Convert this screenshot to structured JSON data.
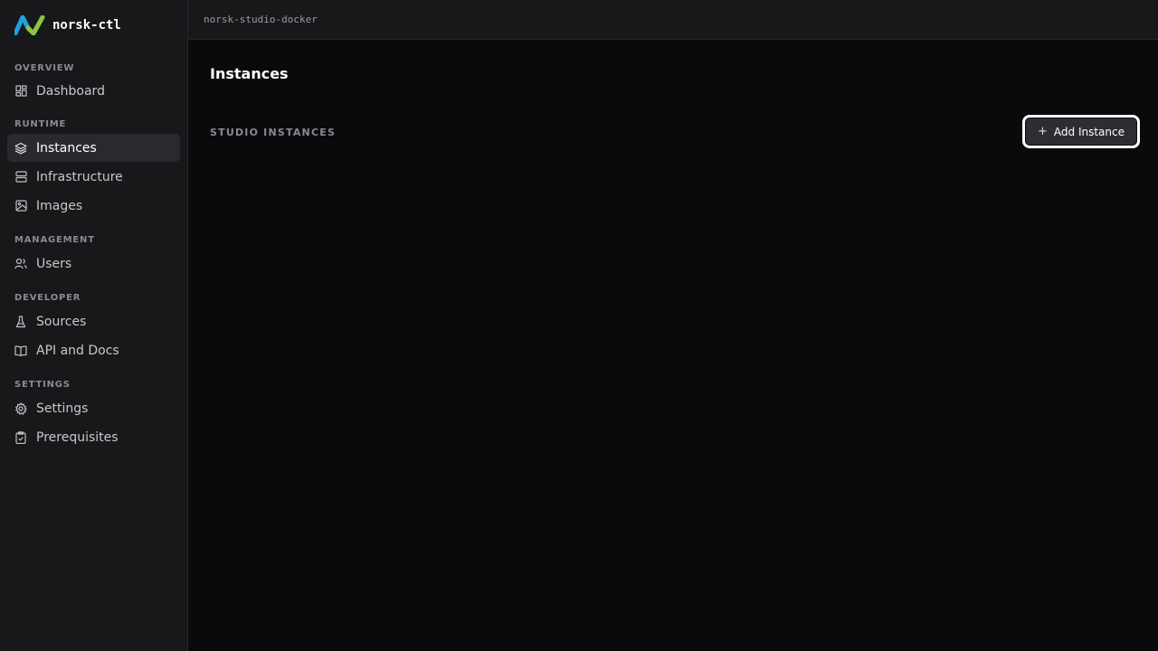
{
  "brand": {
    "name": "norsk-ctl"
  },
  "topbar": {
    "breadcrumb": "norsk-studio-docker"
  },
  "sidebar": {
    "sections": [
      {
        "label": "OVERVIEW",
        "items": [
          {
            "label": "Dashboard",
            "icon": "grid-icon"
          }
        ]
      },
      {
        "label": "RUNTIME",
        "items": [
          {
            "label": "Instances",
            "icon": "layers-icon",
            "active": true
          },
          {
            "label": "Infrastructure",
            "icon": "server-icon"
          },
          {
            "label": "Images",
            "icon": "image-icon"
          }
        ]
      },
      {
        "label": "MANAGEMENT",
        "items": [
          {
            "label": "Users",
            "icon": "users-icon"
          }
        ]
      },
      {
        "label": "DEVELOPER",
        "items": [
          {
            "label": "Sources",
            "icon": "flask-icon"
          },
          {
            "label": "API and Docs",
            "icon": "book-icon"
          }
        ]
      },
      {
        "label": "SETTINGS",
        "items": [
          {
            "label": "Settings",
            "icon": "gear-icon"
          },
          {
            "label": "Prerequisites",
            "icon": "clipboard-check-icon"
          }
        ]
      }
    ]
  },
  "main": {
    "title": "Instances",
    "section_label": "STUDIO INSTANCES",
    "add_button_label": "Add Instance"
  },
  "colors": {
    "logo_blue": "#1fa3e0",
    "logo_green": "#8cc63f",
    "background": "#0a0a0c",
    "sidebar": "#18181b"
  }
}
